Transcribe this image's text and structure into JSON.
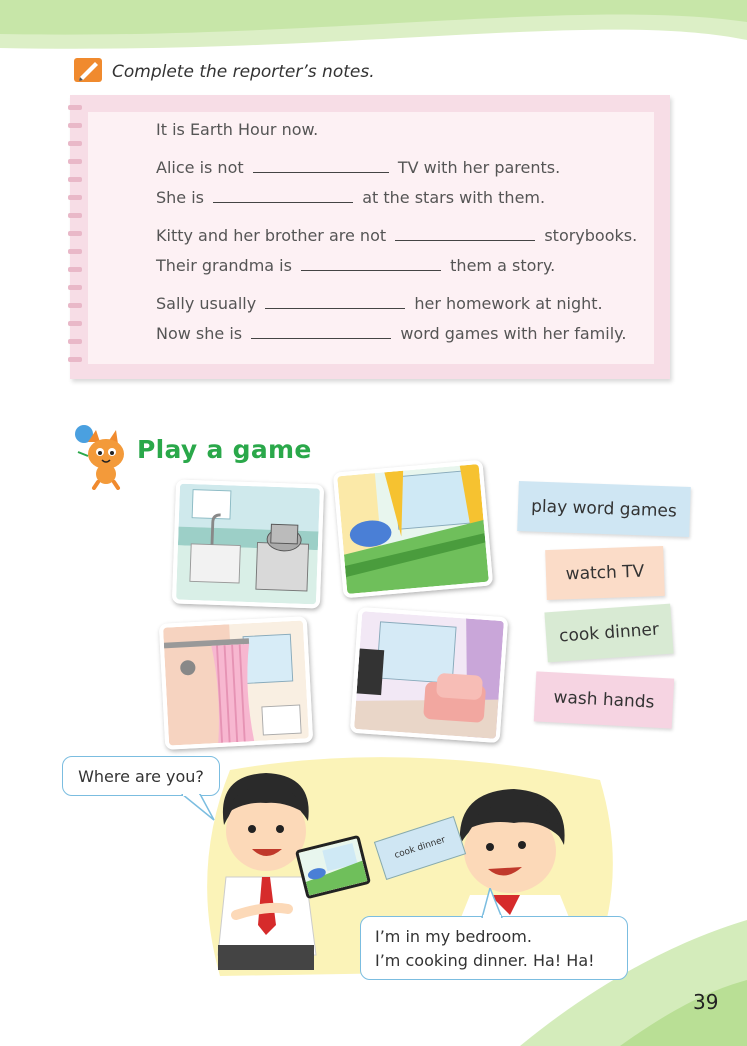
{
  "notes_section": {
    "instruction": "Complete the reporter’s notes.",
    "lines": [
      {
        "before": "It is Earth Hour now.",
        "after": ""
      },
      {
        "before": "Alice is not",
        "after": "TV with her parents."
      },
      {
        "before": "She is",
        "after": "at the stars with them."
      },
      {
        "before": "Kitty and her brother are not",
        "after": "storybooks."
      },
      {
        "before": "Their grandma is",
        "after": "them a story."
      },
      {
        "before": "Sally usually",
        "after": "her homework at night."
      },
      {
        "before": "Now she is",
        "after": "word games with her family."
      }
    ]
  },
  "game_section": {
    "title": "Play a game",
    "pictures": [
      "kitchen",
      "bedroom",
      "bathroom",
      "living room"
    ],
    "cards": [
      "play word games",
      "watch TV",
      "cook dinner",
      "wash hands"
    ],
    "held_card_text": "cook dinner"
  },
  "comic": {
    "bubble_1": "Where are you?",
    "bubble_2_line_1": "I’m in my bedroom.",
    "bubble_2_line_2": "I’m cooking dinner. Ha! Ha!"
  },
  "page_number": "39",
  "colors": {
    "title_green": "#2aa84a",
    "notepad_pink": "#f7dde6",
    "card_blue": "#cfe6f3",
    "card_peach": "#fbdcc8",
    "card_green": "#d8ead3",
    "card_pink": "#f6d4e2",
    "bubble_border": "#7bbde0"
  }
}
